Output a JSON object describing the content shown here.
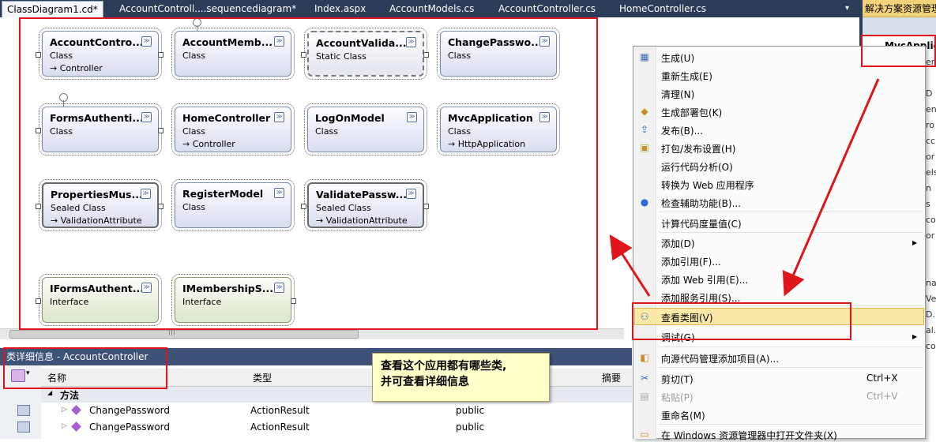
{
  "tabs": [
    {
      "label": "ClassDiagram1.cd*",
      "active": true
    },
    {
      "label": "AccountControll....sequencediagram*"
    },
    {
      "label": "Index.aspx"
    },
    {
      "label": "AccountModels.cs"
    },
    {
      "label": "AccountController.cs"
    },
    {
      "label": "HomeController.cs"
    }
  ],
  "tab_dropdown": "▾",
  "classes": [
    {
      "name": "AccountContro...",
      "kind": "Class",
      "base": "→ Controller"
    },
    {
      "name": "AccountMemb...",
      "kind": "Class",
      "base": ""
    },
    {
      "name": "AccountValida...",
      "kind": "Static Class",
      "base": ""
    },
    {
      "name": "ChangePasswo...",
      "kind": "Class",
      "base": ""
    },
    {
      "name": "FormsAuthenti...",
      "kind": "Class",
      "base": ""
    },
    {
      "name": "HomeController",
      "kind": "Class",
      "base": "→ Controller"
    },
    {
      "name": "LogOnModel",
      "kind": "Class",
      "base": ""
    },
    {
      "name": "MvcApplication",
      "kind": "Class",
      "base": "→ HttpApplication"
    },
    {
      "name": "PropertiesMus...",
      "kind": "Sealed Class",
      "base": "→ ValidationAttribute"
    },
    {
      "name": "RegisterModel",
      "kind": "Class",
      "base": ""
    },
    {
      "name": "ValidatePassw...",
      "kind": "Sealed Class",
      "base": "→ ValidationAttribute"
    },
    {
      "name": "IFormsAuthent...",
      "kind": "Interface",
      "base": ""
    },
    {
      "name": "IMembershipS...",
      "kind": "Interface",
      "base": ""
    }
  ],
  "expand_glyph": "≫",
  "scroll_grip": "|||",
  "solution_explorer": {
    "header": "解决方案资源管理器",
    "project": "MvcApplic",
    "fragments": [
      "er",
      "D",
      "en",
      "ro",
      "cc",
      "or",
      "els",
      "n",
      "s",
      "co",
      "or",
      "Vel",
      "D.",
      "al.",
      "co",
      "na"
    ]
  },
  "bottom_panel": {
    "title": "类详细信息 - AccountController",
    "columns": [
      "名称",
      "类型",
      "摘要"
    ],
    "group": "方法",
    "group_toggle": "◢",
    "rows": [
      {
        "name": "ChangePassword",
        "type": "ActionResult",
        "access": "public"
      },
      {
        "name": "ChangePassword",
        "type": "ActionResult",
        "access": "public"
      }
    ]
  },
  "callout": {
    "line1": "查看这个应用都有哪些类,",
    "line2": "并可查看详细信息"
  },
  "menu": {
    "items": [
      {
        "label": "生成(U)",
        "icon": "build-icon"
      },
      {
        "label": "重新生成(E)"
      },
      {
        "label": "清理(N)"
      },
      {
        "label": "生成部署包(K)",
        "icon": "package-icon"
      },
      {
        "label": "发布(B)...",
        "icon": "publish-icon"
      },
      {
        "label": "打包/发布设置(H)",
        "icon": "settings-icon"
      },
      {
        "label": "运行代码分析(O)"
      },
      {
        "label": "转换为 Web 应用程序"
      },
      {
        "label": "检查辅助功能(B)...",
        "icon": "accessibility-icon"
      },
      {
        "label": "计算代码度量值(C)"
      },
      {
        "label": "添加(D)",
        "submenu": true
      },
      {
        "label": "添加引用(F)..."
      },
      {
        "label": "添加 Web 引用(E)..."
      },
      {
        "label": "添加服务引用(S)..."
      },
      {
        "label": "查看类图(V)",
        "icon": "class-diagram-icon",
        "highlighted": true
      },
      {
        "label": "调试(G)",
        "submenu": true
      },
      {
        "label": "向源代码管理添加项目(A)...",
        "icon": "source-control-icon"
      },
      {
        "label": "剪切(T)",
        "shortcut": "Ctrl+X",
        "icon": "cut-icon"
      },
      {
        "label": "粘贴(P)",
        "shortcut": "Ctrl+V",
        "icon": "paste-icon",
        "disabled": true
      },
      {
        "label": "重命名(M)"
      },
      {
        "label": "在 Windows 资源管理器中打开文件夹(X)",
        "icon": "folder-icon"
      }
    ],
    "submenu_arrow": "▶"
  },
  "colors": {
    "annotation_red": "#e0151c",
    "tab_bar": "#2b3c59",
    "menu_highlight": "#fbe9a8",
    "callout_bg": "#ffffcc"
  }
}
